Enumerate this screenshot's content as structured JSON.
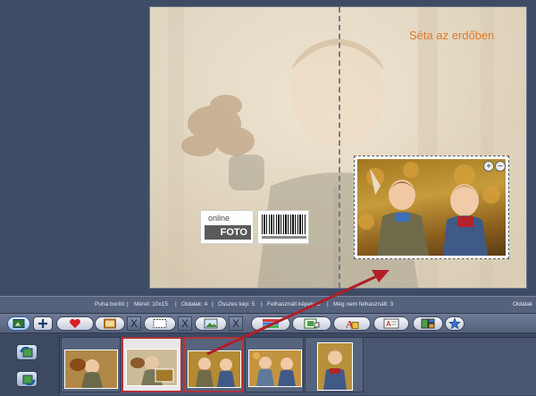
{
  "canvas": {
    "cover_title": "Séta az erdőben",
    "logo": {
      "small_text": "online",
      "big_text": "FOTO"
    },
    "photo_zoom": {
      "zoom_in_label": "+",
      "zoom_out_label": "−"
    }
  },
  "status_bar": {
    "items": [
      "Puha borító",
      "|",
      "Méret: 10x15",
      "|",
      "Oldalak: 4",
      "|",
      "Összes kép: 5",
      "|",
      "Felhasznált képek: 2",
      "|",
      "Még nem felhasznált: 3"
    ],
    "right_label": "Oldalak"
  },
  "toolbar": {
    "buttons": [
      {
        "name": "add-page-button",
        "icon": "page-plus-icon"
      },
      {
        "name": "add-button",
        "icon": "plus-icon"
      },
      {
        "name": "favorite-button",
        "icon": "heart-icon"
      },
      {
        "name": "frame-button",
        "icon": "frame-icon"
      },
      {
        "name": "remove-frame-button",
        "icon": "x-icon"
      },
      {
        "name": "border-button",
        "icon": "dashed-border-icon"
      },
      {
        "name": "remove-border-button",
        "icon": "x-icon"
      },
      {
        "name": "image-button",
        "icon": "image-icon"
      },
      {
        "name": "remove-image-button",
        "icon": "x-icon"
      },
      {
        "name": "color-bars-button",
        "icon": "color-bars-icon"
      },
      {
        "name": "photo-frame-button",
        "icon": "photo-frame-icon"
      },
      {
        "name": "text-style-button",
        "icon": "text-a-icon"
      },
      {
        "name": "text-box-button",
        "icon": "text-box-icon"
      },
      {
        "name": "layout-button",
        "icon": "layout-icon"
      },
      {
        "name": "star-button",
        "icon": "star-icon"
      }
    ],
    "x_label": "X"
  },
  "filmstrip": {
    "side_buttons": [
      {
        "name": "rotate-left-button",
        "icon": "rotate-left-icon"
      },
      {
        "name": "rotate-right-button",
        "icon": "rotate-right-icon"
      }
    ],
    "thumbnails": [
      {
        "name": "thumb-1",
        "desc": "child with leaves"
      },
      {
        "name": "thumb-2",
        "desc": "cover spread",
        "selected": true
      },
      {
        "name": "thumb-3",
        "desc": "two kids",
        "selected": true
      },
      {
        "name": "thumb-4",
        "desc": "two kids leaves"
      },
      {
        "name": "thumb-5",
        "desc": "child portrait"
      }
    ]
  }
}
